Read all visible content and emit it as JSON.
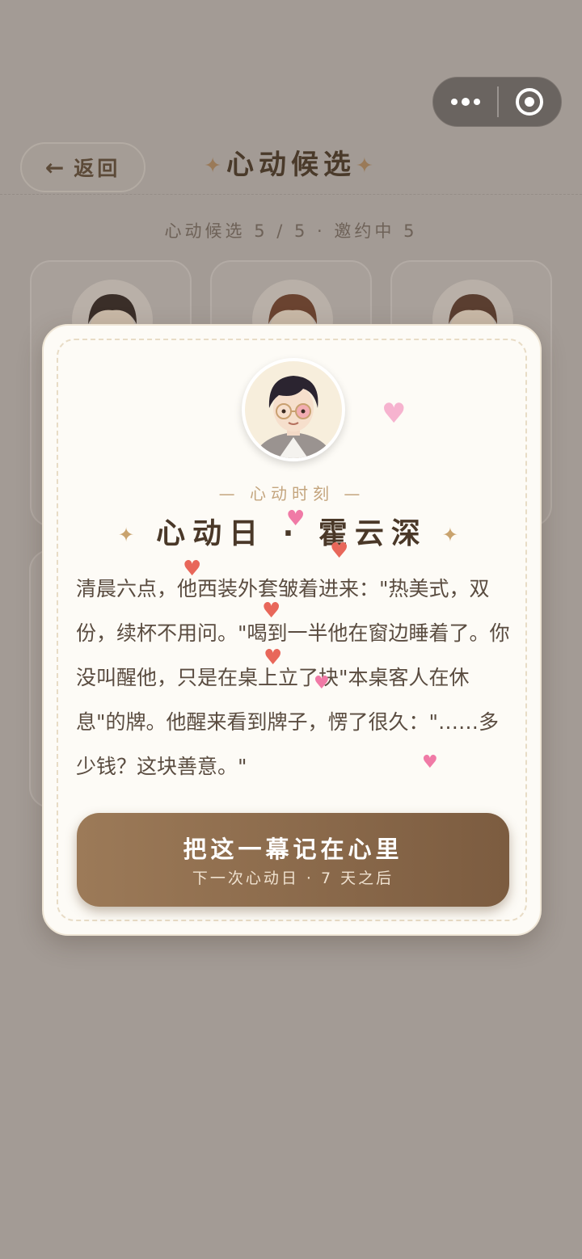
{
  "capsule": {
    "more_icon": "more-dots-icon",
    "close_icon": "target-close-icon"
  },
  "header": {
    "back_label": "返回",
    "back_icon": "←",
    "title": "心动候选",
    "title_spark": "✦"
  },
  "stats": "心动候选 5 / 5 · 邀约中 5",
  "modal": {
    "label": "— 心动时刻 —",
    "title": "心动日 · 霍云深",
    "title_spark": "✦",
    "story": "清晨六点，他西装外套皱着进来：\"热美式，双份，续杯不用问。\"喝到一半他在窗边睡着了。你没叫醒他，只是在桌上立了块\"本桌客人在休息\"的牌。他醒来看到牌子，愣了很久：\"……多少钱？这块善意。\"",
    "cta_main": "把这一幕记在心里",
    "cta_sub": "下一次心动日 · 7 天之后"
  },
  "colors": {
    "accent": "#8c6a4c",
    "overlay": "#a39b95",
    "modal_bg": "#fdfbf6"
  }
}
